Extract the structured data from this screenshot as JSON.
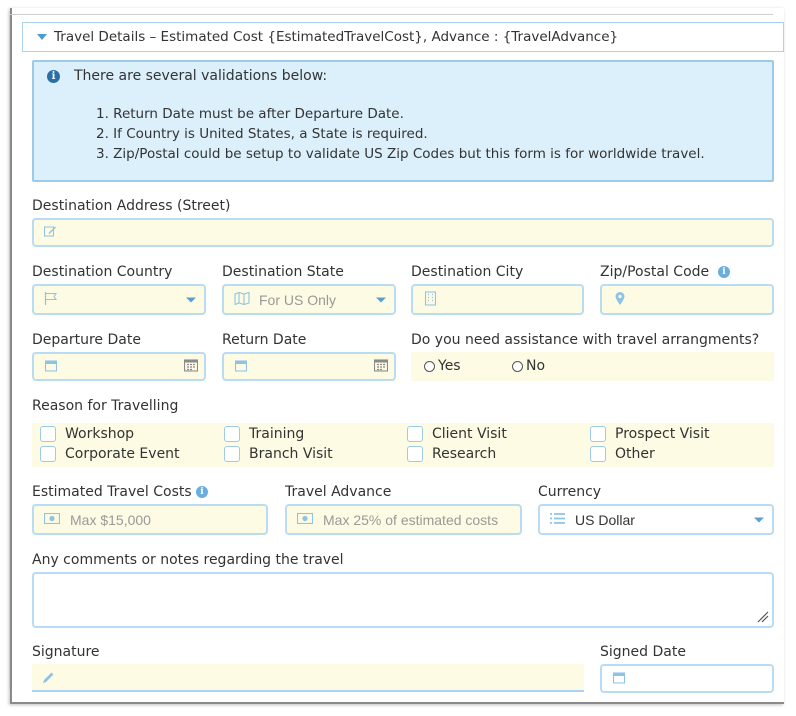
{
  "panel": {
    "title": "Travel Details – Estimated Cost {EstimatedTravelCost}, Advance : {TravelAdvance}"
  },
  "info": {
    "icon": "info-circle-icon",
    "title": "There are several validations below:",
    "items": [
      "1. Return Date must be after Departure Date.",
      "2. If Country is United States, a State is required.",
      "3. Zip/Postal could be setup to validate US Zip Codes but this form is for worldwide travel."
    ]
  },
  "fields": {
    "street_label": "Destination Address (Street)",
    "country_label": "Destination Country",
    "state_label": "Destination State",
    "state_placeholder": "For US Only",
    "city_label": "Destination City",
    "zip_label": "Zip/Postal Code",
    "departure_label": "Departure Date",
    "return_label": "Return Date",
    "assist_label": "Do you need assistance with travel arrangments?",
    "assist_yes": "Yes",
    "assist_no": "No",
    "reason_label": "Reason for Travelling",
    "reasons": [
      "Workshop",
      "Training",
      "Client Visit",
      "Prospect Visit",
      "Corporate Event",
      "Branch Visit",
      "Research",
      "Other"
    ],
    "est_cost_label": "Estimated Travel Costs",
    "est_cost_placeholder": "Max $15,000",
    "advance_label": "Travel Advance",
    "advance_placeholder": "Max 25% of estimated costs",
    "currency_label": "Currency",
    "currency_value": "US Dollar",
    "comments_label": "Any comments or notes regarding the travel",
    "signature_label": "Signature",
    "signed_date_label": "Signed Date"
  },
  "colors": {
    "accent": "#4a9ad8",
    "field_bg": "#fdfbe3",
    "field_border": "#b8dcf4",
    "info_bg": "#dcf0fb"
  }
}
